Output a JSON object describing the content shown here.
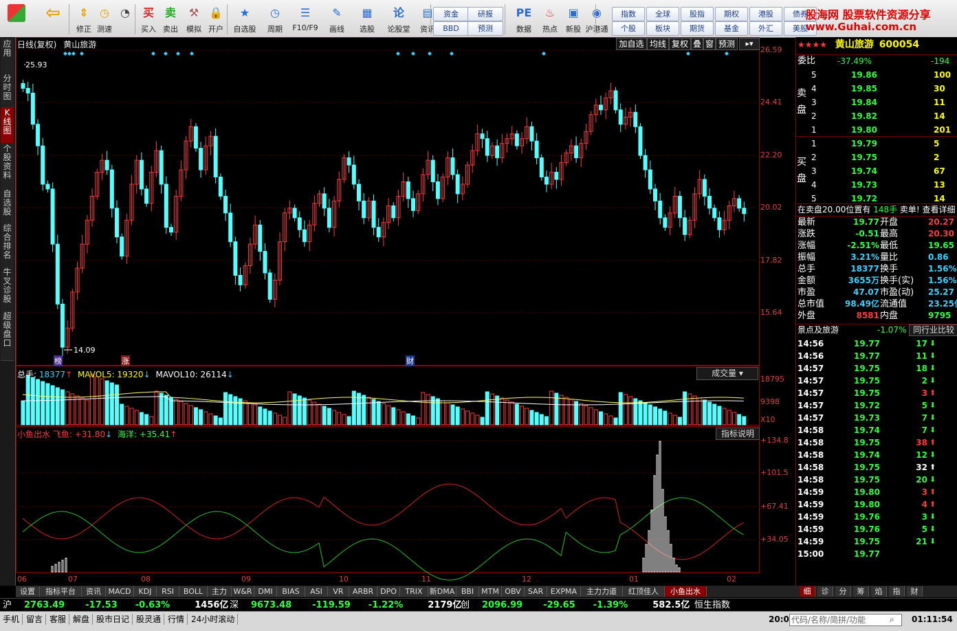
{
  "toolbar": {
    "buttons": [
      {
        "label": "修正",
        "icon": "up-down-arrow-icon"
      },
      {
        "label": "测速",
        "icon": "clock-icon"
      },
      {
        "label": "",
        "icon": "stopwatch-icon"
      },
      {
        "label": "买入",
        "icon": "buy-icon",
        "glyph": "买"
      },
      {
        "label": "卖出",
        "icon": "sell-icon",
        "glyph": "卖"
      },
      {
        "label": "模拟",
        "icon": "hammer-icon"
      },
      {
        "label": "开户",
        "icon": "lock-icon"
      },
      {
        "label": "自选股",
        "icon": "star-icon"
      },
      {
        "label": "周期",
        "icon": "clock-icon"
      },
      {
        "label": "F10/F9",
        "icon": "list-icon"
      },
      {
        "label": "画线",
        "icon": "pen-icon"
      },
      {
        "label": "选股",
        "icon": "grid-icon"
      },
      {
        "label": "论股堂",
        "icon": "discuss-icon",
        "glyph": "论"
      },
      {
        "label": "资讯",
        "icon": "doc-icon"
      },
      {
        "label": "数据",
        "icon": "pe-icon",
        "glyph": "PE"
      },
      {
        "label": "热点",
        "icon": "hot-icon"
      },
      {
        "label": "新股",
        "icon": "new-icon"
      },
      {
        "label": "沪港通",
        "icon": "hk-icon"
      }
    ],
    "group1": [
      "资金",
      "研报",
      "BBD",
      "预测"
    ],
    "group2": [
      "指数",
      "全球",
      "股指",
      "期权",
      "港股",
      "债券",
      "个股",
      "板块",
      "期货",
      "基金",
      "外汇",
      "美股"
    ],
    "brand": "股海网 股票软件资源分享",
    "brand_url": "www.Guhai.com.cn"
  },
  "left_tabs": [
    "应用",
    "分时图",
    "K线图",
    "个股资料",
    "自选股",
    "综合排名",
    "牛叉诊股",
    "超级盘口"
  ],
  "chart": {
    "title": "日线(复权)",
    "stock_name": "黄山旅游",
    "buttons": [
      "加自选",
      "均线",
      "复权",
      "叠",
      "窗",
      "预测"
    ],
    "price_high_label": "25.93",
    "price_low_label": "14.09",
    "markers": [
      "榜",
      "涨",
      "财"
    ],
    "vol_header": {
      "label": "总手:",
      "value": "18377",
      "ma5_label": "MAVOL5:",
      "ma5": "19320",
      "ma10_label": "MAVOL10:",
      "ma10": "26114"
    },
    "vol_dropdown": "成交量",
    "ind_header": {
      "name": "小鱼出水",
      "fly_label": "飞鱼:",
      "fly": "+31.80",
      "sea_label": "海洋:",
      "sea": "+35.41"
    },
    "ind_button": "指标说明",
    "price_axis": [
      "26.59",
      "24.41",
      "22.20",
      "20.02",
      "17.82",
      "15.64"
    ],
    "vol_axis": [
      "18795",
      "9398",
      "X10"
    ],
    "ind_axis": [
      "+134.8",
      "+101.5",
      "+67.41",
      "+34.05"
    ],
    "months": [
      "06",
      "07",
      "08",
      "09",
      "10",
      "11",
      "12",
      "01",
      "02"
    ]
  },
  "chart_data": {
    "type": "candlestick",
    "title": "黄山旅游",
    "ylim": [
      14.09,
      26.59
    ],
    "close": [
      25.0,
      24.8,
      23.5,
      22.6,
      21.0,
      20.8,
      18.5,
      16.0,
      14.2,
      15.0,
      16.5,
      17.5,
      18.5,
      19.5,
      20.5,
      21.5,
      22.0,
      21.6,
      20.0,
      18.8,
      18.0,
      19.5,
      21.0,
      22.0,
      20.8,
      20.2,
      21.5,
      22.4,
      21.0,
      19.2,
      19.0,
      20.5,
      21.6,
      22.8,
      23.4,
      22.5,
      21.6,
      22.6,
      23.0,
      21.3,
      20.5,
      19.8,
      18.6,
      17.2,
      16.8,
      17.6,
      18.5,
      19.3,
      18.2,
      17.3,
      16.2,
      17.0,
      18.6,
      19.8,
      20.0,
      19.6,
      19.1,
      18.6,
      19.3,
      20.2,
      20.6,
      20.0,
      19.2,
      20.3,
      21.2,
      22.1,
      21.8,
      21.0,
      20.3,
      19.6,
      20.3,
      19.2,
      18.8,
      19.4,
      20.1,
      19.6,
      20.5,
      21.1,
      20.4,
      19.9,
      20.6,
      21.4,
      22.0,
      21.1,
      20.4,
      21.3,
      22.1,
      21.4,
      20.6,
      21.0,
      21.8,
      22.4,
      23.1,
      22.9,
      22.2,
      22.6,
      22.1,
      22.7,
      22.9,
      23.1,
      22.6,
      22.9,
      23.4,
      22.8,
      22.1,
      21.3,
      21.0,
      21.5,
      21.2,
      21.9,
      22.3,
      22.6,
      22.1,
      22.7,
      23.2,
      23.9,
      24.3,
      24.1,
      24.6,
      24.9,
      24.1,
      23.5,
      23.8,
      24.0,
      23.4,
      22.2,
      21.6,
      20.8,
      20.3,
      19.6,
      19.2,
      19.8,
      20.5,
      19.6,
      18.9,
      19.5,
      20.6,
      21.2,
      20.5,
      20.0,
      19.6,
      19.1,
      19.5,
      20.1,
      20.4,
      20.0,
      19.77
    ]
  },
  "right_panel": {
    "stars": "★★★★",
    "name": "黄山旅游",
    "code": "600054",
    "weibi_label": "委比",
    "weibi": "-37.49%",
    "weicha": "-194",
    "sell_label": "卖盘",
    "buy_label": "买盘",
    "sells": [
      [
        "5",
        "19.86",
        "100"
      ],
      [
        "4",
        "19.85",
        "30"
      ],
      [
        "3",
        "19.84",
        "11"
      ],
      [
        "2",
        "19.82",
        "14"
      ],
      [
        "1",
        "19.80",
        "201"
      ]
    ],
    "buys": [
      [
        "1",
        "19.79",
        "5"
      ],
      [
        "2",
        "19.75",
        "2"
      ],
      [
        "3",
        "19.74",
        "67"
      ],
      [
        "4",
        "19.73",
        "13"
      ],
      [
        "5",
        "19.72",
        "14"
      ]
    ],
    "notice": "在卖盘20.00位置有",
    "notice_qty": "148手",
    "notice_tail": "卖单! 查看详细",
    "stats": [
      [
        "最新",
        "19.77",
        "开盘",
        "20.27"
      ],
      [
        "涨跌",
        "-0.51",
        "最高",
        "20.30"
      ],
      [
        "涨幅",
        "-2.51%",
        "最低",
        "19.65"
      ],
      [
        "振幅",
        "3.21%",
        "量比",
        "0.86"
      ],
      [
        "总手",
        "18377",
        "换手",
        "1.56%"
      ],
      [
        "金额",
        "3655万",
        "换手(实)",
        "1.56%"
      ],
      [
        "市盈",
        "47.07",
        "市盈(动)",
        "25.27"
      ],
      [
        "总市值",
        "98.49亿",
        "流通值",
        "23.25亿"
      ],
      [
        "外盘",
        "8581",
        "内盘",
        "9795"
      ]
    ],
    "sector_label": "景点及旅游",
    "sector_change": "-1.07%",
    "sector_btn": "同行业比较",
    "ticks": [
      [
        "14:56",
        "19.77",
        "17",
        "d"
      ],
      [
        "14:56",
        "19.77",
        "11",
        "d"
      ],
      [
        "14:57",
        "19.75",
        "18",
        "d"
      ],
      [
        "14:57",
        "19.75",
        "2",
        "d"
      ],
      [
        "14:57",
        "19.75",
        "3",
        "u"
      ],
      [
        "14:57",
        "19.72",
        "5",
        "d"
      ],
      [
        "14:57",
        "19.73",
        "7",
        "d"
      ],
      [
        "14:58",
        "19.74",
        "7",
        "d"
      ],
      [
        "14:58",
        "19.75",
        "38",
        "u"
      ],
      [
        "14:58",
        "19.74",
        "12",
        "d"
      ],
      [
        "14:58",
        "19.75",
        "32",
        "w"
      ],
      [
        "14:58",
        "19.75",
        "20",
        "d"
      ],
      [
        "14:59",
        "19.80",
        "3",
        "u"
      ],
      [
        "14:59",
        "19.80",
        "4",
        "u"
      ],
      [
        "14:59",
        "19.76",
        "3",
        "d"
      ],
      [
        "14:59",
        "19.76",
        "5",
        "d"
      ],
      [
        "14:59",
        "19.75",
        "21",
        "d"
      ],
      [
        "15:00",
        "19.77",
        "",
        ""
      ]
    ],
    "bottom_tabs": [
      "细",
      "诊",
      "分",
      "筹",
      "焰",
      "指",
      "财"
    ]
  },
  "bottom_tabs": [
    "设置",
    "指标平台",
    "资讯",
    "MACD",
    "KDJ",
    "RSI",
    "BOLL",
    "主力",
    "W&R",
    "DMI",
    "BIAS",
    "ASI",
    "VR",
    "ARBR",
    "DPO",
    "TRIX",
    "新DMA",
    "BBI",
    "MTM",
    "OBV",
    "SAR",
    "EXPMA",
    "主力力道",
    "红顶佳人",
    "小鱼出水"
  ],
  "index_bar": [
    {
      "name": "沪",
      "value": "2763.49",
      "chg": "-17.53",
      "pct": "-0.63%",
      "amt": "1456亿"
    },
    {
      "name": "深",
      "value": "9673.48",
      "chg": "-119.59",
      "pct": "-1.22%",
      "amt": "2179亿"
    },
    {
      "name": "创",
      "value": "2096.99",
      "chg": "-29.65",
      "pct": "-1.39%",
      "amt": "582.5亿"
    },
    {
      "name": "恒生指数",
      "value": "",
      "chg": "",
      "pct": "",
      "amt": ""
    }
  ],
  "status_bar": {
    "items": [
      "手机",
      "留言",
      "客服",
      "解盘",
      "股市日记",
      "股灵通",
      "行情",
      "24小时滚动"
    ],
    "code_label": "20:0",
    "search_placeholder": "代码/名称/简拼/功能",
    "time": "01:11:54"
  },
  "colors": {
    "up": "#ff3b3b",
    "down": "#54ffff",
    "axis": "#e04040",
    "bg": "#000000"
  }
}
